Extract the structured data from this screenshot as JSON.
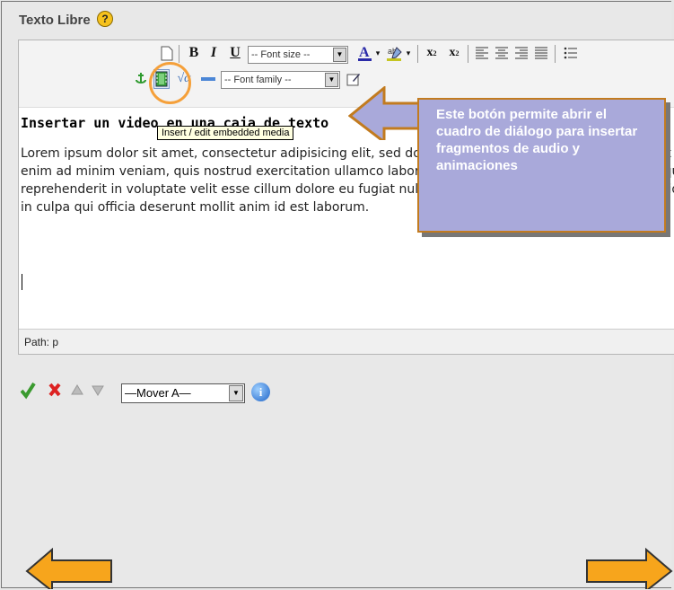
{
  "title": "Texto Libre",
  "toolbar": {
    "row1": [
      "B",
      "I",
      "U"
    ],
    "font_size_placeholder": "-- Font size --",
    "font_family_placeholder": "-- Font family --"
  },
  "content": {
    "heading": "Insertar un video en una caja de texto",
    "para_lines": [
      "Lorem ipsum dolor sit amet, consectetur adipisicing elit, sed do eiusmod tempor incididunt ut labore et dolore magna aliqua. Ut enim",
      "enim ad minim veniam, quis nostrud exercitation ullamco laboris nisi ut aliquip ex ea commodo consequat. Duis aute irure dolor in",
      "reprehenderit in voluptate velit esse cillum dolore eu fugiat nulla pariatur. Excepteur sint occaecat cupidatat non proident, sunt",
      "in culpa qui officia deserunt mollit anim id est laborum."
    ]
  },
  "path_label": "Path: p",
  "tooltip": "Insert / edit embedded media",
  "callout": "Este botón permite abrir el cuadro de diálogo para insertar fragmentos de audio y animaciones",
  "bottom": {
    "select_value": "—Mover A—"
  },
  "colors": {
    "arrow_fill": "#f7a51c",
    "callout_fill": "#a9a9da",
    "highlight": "#f5a03a"
  }
}
